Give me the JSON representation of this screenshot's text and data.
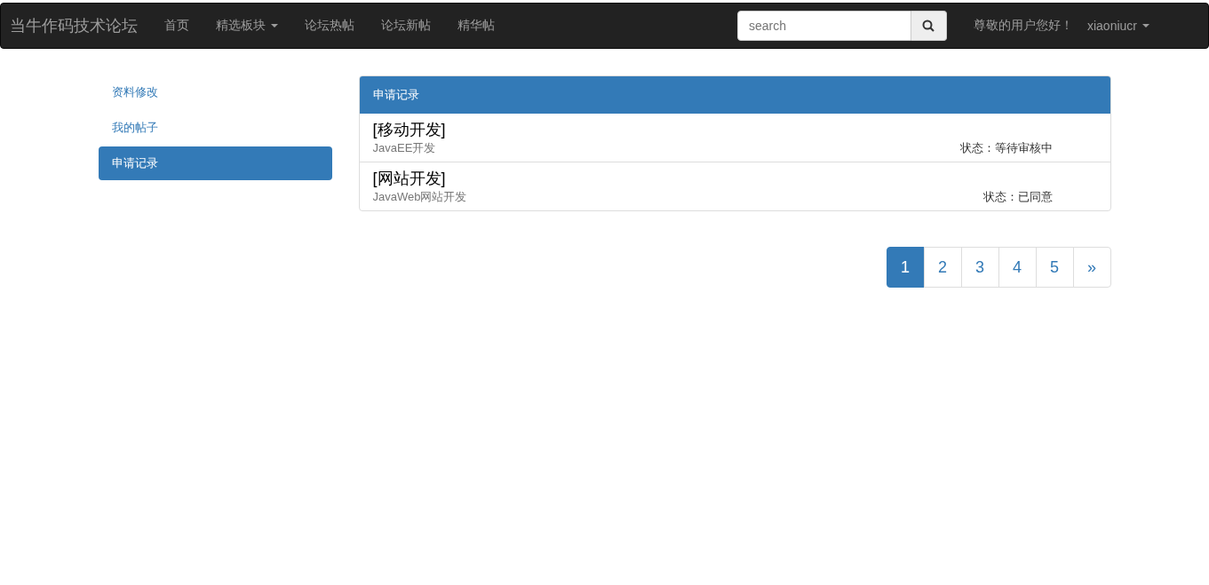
{
  "navbar": {
    "brand": "当牛作码技术论坛",
    "items": [
      {
        "label": "首页",
        "kind": "link"
      },
      {
        "label": "精选板块",
        "kind": "dropdown"
      },
      {
        "label": "论坛热帖",
        "kind": "link"
      },
      {
        "label": "论坛新帖",
        "kind": "link"
      },
      {
        "label": "精华帖",
        "kind": "link"
      }
    ],
    "search": {
      "placeholder": "search"
    },
    "greeting": "尊敬的用户您好！",
    "user": "xiaoniucr"
  },
  "sidebar": {
    "items": [
      {
        "label": "资料修改",
        "selected": false
      },
      {
        "label": "我的帖子",
        "selected": false
      },
      {
        "label": "申请记录",
        "selected": true
      }
    ]
  },
  "panel": {
    "title": "申请记录",
    "records": [
      {
        "title": "[移动开发]",
        "subtitle": "JavaEE开发",
        "status": "状态：等待审核中"
      },
      {
        "title": "[网站开发]",
        "subtitle": "JavaWeb网站开发",
        "status": "状态：已同意"
      }
    ]
  },
  "pagination": [
    {
      "label": "1",
      "selected": true
    },
    {
      "label": "2",
      "selected": false
    },
    {
      "label": "3",
      "selected": false
    },
    {
      "label": "4",
      "selected": false
    },
    {
      "label": "5",
      "selected": false
    },
    {
      "label": "»",
      "selected": false
    }
  ]
}
